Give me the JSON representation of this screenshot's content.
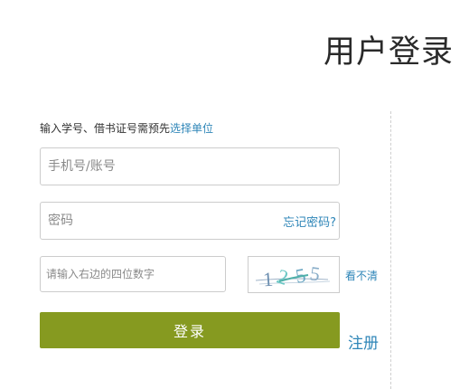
{
  "header": {
    "title": "用户登录"
  },
  "form": {
    "hint_text": "输入学号、借书证号需预先",
    "hint_link": "选择单位",
    "account": {
      "placeholder": "手机号/账号",
      "value": ""
    },
    "password": {
      "placeholder": "密码",
      "value": "",
      "forgot_label": "忘记密码?"
    },
    "captcha": {
      "placeholder": "请输入右边的四位数字",
      "value": "",
      "image_text": "1255",
      "refresh_label": "看不清"
    },
    "login_label": "登录",
    "register_label": "注册"
  },
  "colors": {
    "accent_green": "#869a20",
    "link_blue": "#2f86b8"
  },
  "icons": {
    "captcha": "captcha-image"
  }
}
